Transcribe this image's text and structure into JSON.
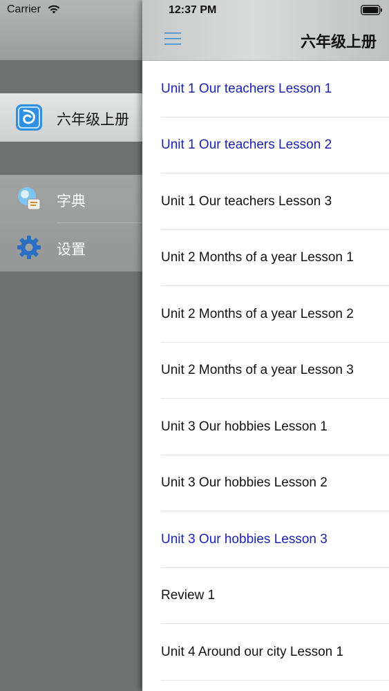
{
  "status_bar": {
    "carrier": "Carrier",
    "time": "12:37 PM"
  },
  "side_menu": {
    "items": [
      {
        "label": "六年级上册",
        "icon": "book-app-icon",
        "selected": true
      },
      {
        "label": "字典",
        "icon": "dictionary-icon",
        "selected": false
      },
      {
        "label": "设置",
        "icon": "gear-icon",
        "selected": false
      }
    ]
  },
  "nav_bar": {
    "title": "六年级上册",
    "menu_icon": "hamburger-icon"
  },
  "lessons": [
    {
      "title": "Unit 1 Our teachers Lesson 1",
      "highlight": true
    },
    {
      "title": "Unit 1 Our teachers Lesson 2",
      "highlight": true
    },
    {
      "title": "Unit 1 Our teachers Lesson 3",
      "highlight": false
    },
    {
      "title": "Unit 2 Months of a year Lesson 1",
      "highlight": false
    },
    {
      "title": "Unit 2 Months of a year Lesson 2",
      "highlight": false
    },
    {
      "title": "Unit 2 Months of a year Lesson 3",
      "highlight": false
    },
    {
      "title": "Unit 3 Our hobbies Lesson 1",
      "highlight": false
    },
    {
      "title": "Unit 3 Our hobbies Lesson 2",
      "highlight": false
    },
    {
      "title": "Unit 3 Our hobbies Lesson 3",
      "highlight": true
    },
    {
      "title": "Review 1",
      "highlight": false
    },
    {
      "title": "Unit 4 Around our city Lesson 1",
      "highlight": false
    }
  ],
  "colors": {
    "highlight_text": "#1b22b8",
    "accent_icon": "#3a8fd9"
  }
}
